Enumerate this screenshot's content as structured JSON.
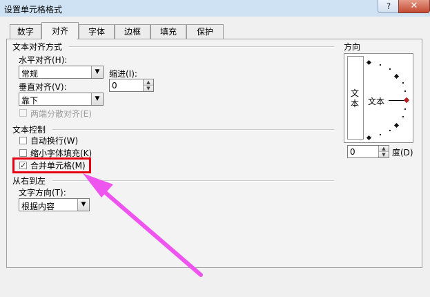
{
  "window": {
    "title": "设置单元格格式",
    "help_label": "?",
    "close_label": "✕"
  },
  "tabs": [
    {
      "label": "数字"
    },
    {
      "label": "对齐"
    },
    {
      "label": "字体"
    },
    {
      "label": "边框"
    },
    {
      "label": "填充"
    },
    {
      "label": "保护"
    }
  ],
  "text_alignment": {
    "group_label": "文本对齐方式",
    "horizontal_label": "水平对齐(H):",
    "horizontal_value": "常规",
    "indent_label": "缩进(I):",
    "indent_value": "0",
    "vertical_label": "垂直对齐(V):",
    "vertical_value": "靠下",
    "justify_distributed_label": "两端分散对齐(E)"
  },
  "text_control": {
    "group_label": "文本控制",
    "wrap_text_label": "自动换行(W)",
    "wrap_text_checked": false,
    "shrink_to_fit_label": "缩小字体填充(K)",
    "shrink_to_fit_checked": false,
    "merge_cells_label": "合并单元格(M)",
    "merge_cells_checked": true,
    "check_glyph": "✓"
  },
  "right_to_left": {
    "group_label": "从右到左",
    "direction_label": "文字方向(T):",
    "direction_value": "根据内容"
  },
  "orientation": {
    "group_label": "方向",
    "vertical_text_char_1": "文",
    "vertical_text_char_2": "本",
    "horizontal_text": "文本",
    "degree_value": "0",
    "degree_label": "度(D)"
  },
  "annotation": {
    "highlight_color": "#e60012",
    "arrow_color": "#ee55ee"
  }
}
